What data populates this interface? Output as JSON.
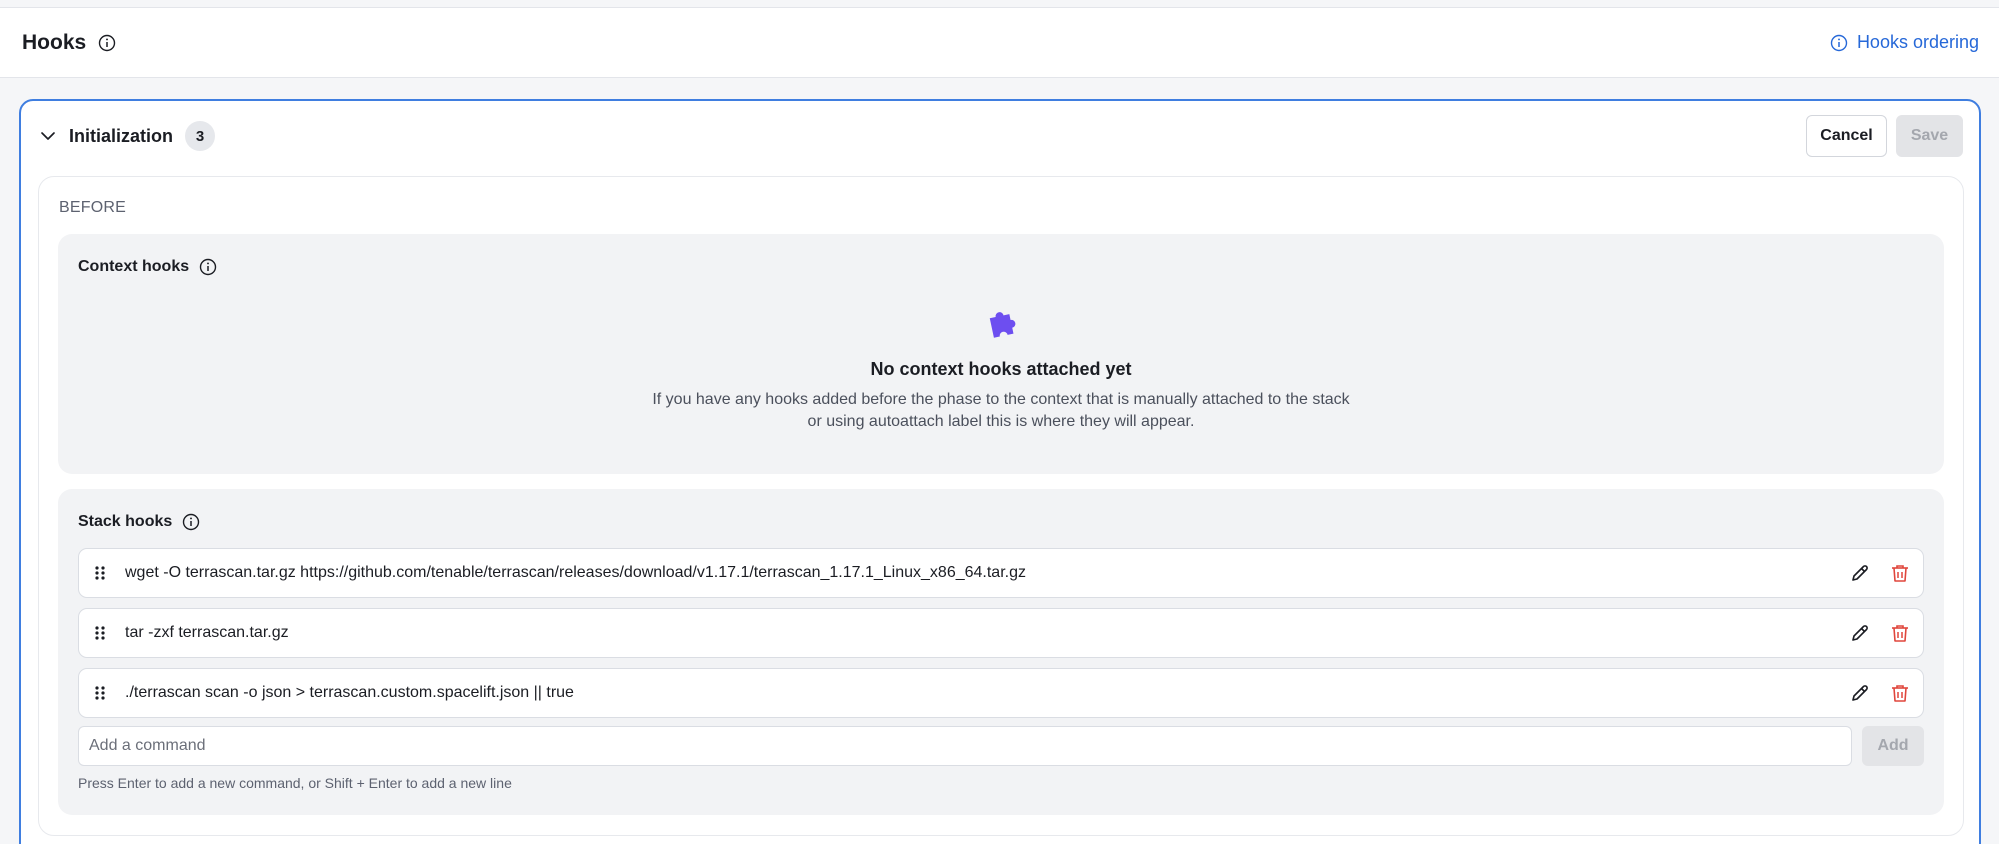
{
  "header": {
    "title": "Hooks",
    "info_icon": "info-icon",
    "ordering_link": "Hooks ordering"
  },
  "section": {
    "title": "Initialization",
    "count": "3",
    "cancel_label": "Cancel",
    "save_label": "Save",
    "phase": "BEFORE"
  },
  "context_hooks": {
    "title": "Context hooks",
    "empty_icon": "puzzle-icon",
    "empty_title": "No context hooks attached yet",
    "empty_line1": "If you have any hooks added before the phase to the context that is manually attached to the stack",
    "empty_line2": "or using autoattach label this is where they will appear."
  },
  "stack_hooks": {
    "title": "Stack hooks",
    "commands": [
      "wget -O terrascan.tar.gz https://github.com/tenable/terrascan/releases/download/v1.17.1/terrascan_1.17.1_Linux_x86_64.tar.gz",
      "tar -zxf terrascan.tar.gz",
      "./terrascan scan -o json > terrascan.custom.spacelift.json || true"
    ],
    "input_placeholder": "Add a command",
    "add_label": "Add",
    "hint": "Press Enter to add a new command, or Shift + Enter to add a new line"
  },
  "colors": {
    "accent": "#2668d8",
    "card_border": "#3f7ee0",
    "puzzle": "#6d4ef0",
    "delete": "#e0463c"
  }
}
